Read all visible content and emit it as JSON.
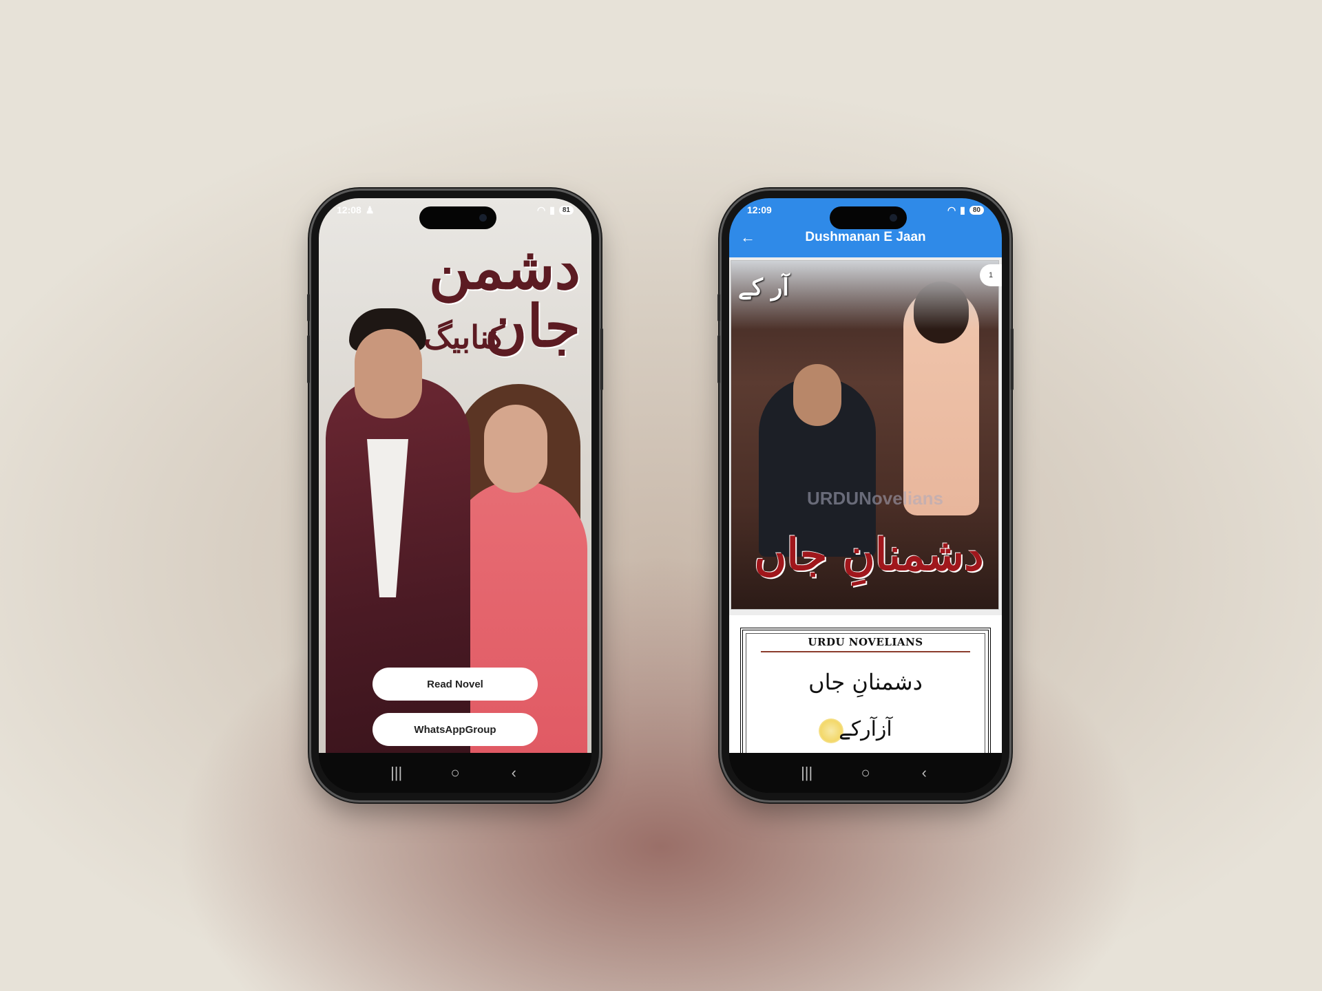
{
  "phone1": {
    "status": {
      "time": "12:08",
      "battery": "81"
    },
    "cover": {
      "title_urdu": "دشمن جان",
      "author_urdu": "کنابیگ"
    },
    "buttons": {
      "read_novel": "Read Novel",
      "whatsapp_group": "WhatsAppGroup"
    }
  },
  "phone2": {
    "status": {
      "time": "12:09",
      "battery": "80"
    },
    "appbar": {
      "title": "Dushmanan E Jaan"
    },
    "page_badge": "1",
    "cover": {
      "author_urdu": "آر کے",
      "watermark": "URDUNovelians",
      "title_urdu": "دشمنانِ جاں"
    },
    "title_page": {
      "brand": "URDU NOVELIANS",
      "title_urdu": "دشمنانِ جاں",
      "author_urdu": "آزآرکے"
    }
  },
  "icons": {
    "back": "arrow-left",
    "recents": "recents-bars",
    "home": "home-circle",
    "navback": "chevron-left",
    "wifi": "wifi",
    "signal": "signal"
  }
}
